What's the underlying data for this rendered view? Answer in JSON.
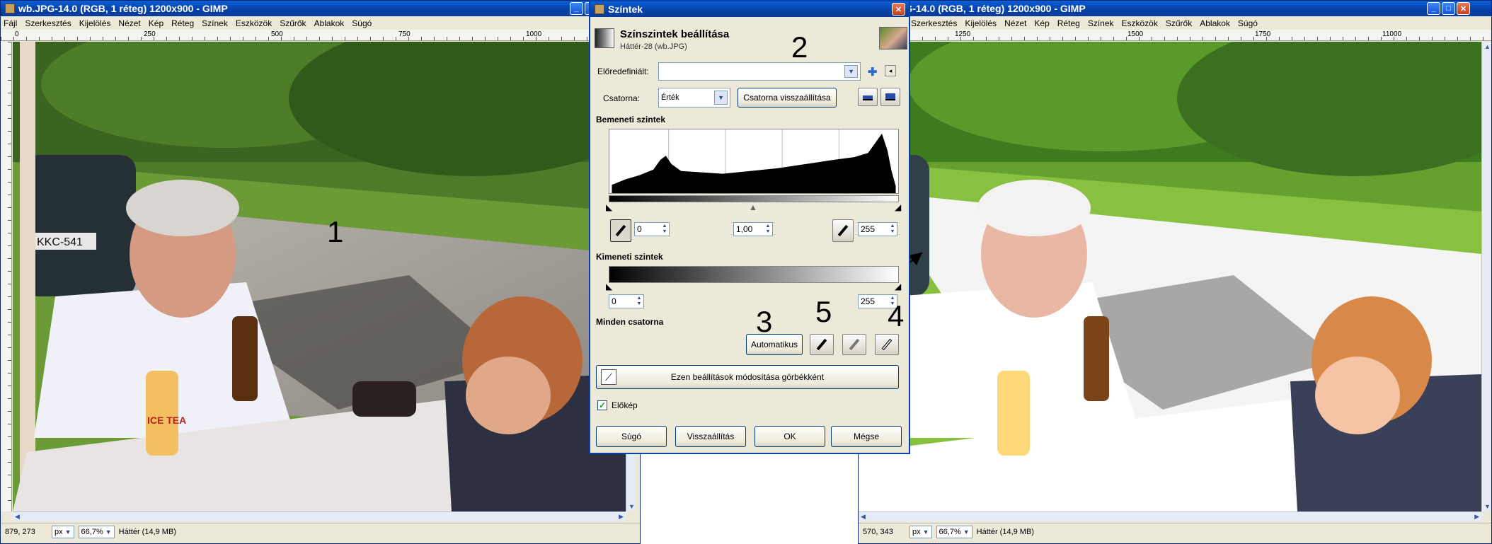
{
  "left_window": {
    "title": "wb.JPG-14.0 (RGB, 1 réteg) 1200x900 - GIMP",
    "menu": [
      "Fájl",
      "Szerkesztés",
      "Kijelölés",
      "Nézet",
      "Kép",
      "Réteg",
      "Színek",
      "Eszközök",
      "Szűrők",
      "Ablakok",
      "Súgó"
    ],
    "ruler_labels": [
      "0",
      "250",
      "500",
      "750",
      "1000"
    ],
    "status": {
      "coords": "879, 273",
      "unit": "px",
      "zoom": "66,7%",
      "layer_info": "Háttér (14,9 MB)"
    }
  },
  "right_window": {
    "title": "wb.JPG-14.0 (RGB, 1 réteg) 1200x900 - GIMP",
    "menu": [
      "Szerkesztés",
      "Kijelölés",
      "Nézet",
      "Kép",
      "Réteg",
      "Színek",
      "Eszközök",
      "Szűrők",
      "Ablakok",
      "Súgó"
    ],
    "ruler_labels": [
      "1250",
      "1500",
      "1750",
      "11000"
    ],
    "status": {
      "coords": "570, 343",
      "unit": "px",
      "zoom": "66,7%",
      "layer_info": "Háttér (14,9 MB)"
    }
  },
  "photo": {
    "license_plate": "KKC-541",
    "bottle_label": "ICE TEA"
  },
  "dialog": {
    "title": "Színtek",
    "header_title": "Színszintek beállítása",
    "header_subtitle": "Háttér-28 (wb.JPG)",
    "preset_label": "Előredefiniált:",
    "preset_value": "",
    "channel_label": "Csatorna:",
    "channel_value": "Érték",
    "reset_channel_button": "Csatorna visszaállítása",
    "input_levels_label": "Bemeneti szintek",
    "input_low": "0",
    "input_gamma": "1,00",
    "input_high": "255",
    "output_levels_label": "Kimeneti szintek",
    "output_low": "0",
    "output_high": "255",
    "all_channels_label": "Minden csatorna",
    "auto_button": "Automatikus",
    "curves_button": "Ezen beállítások módosítása görbékként",
    "preview_label": "Előkép",
    "preview_checked": true,
    "help_button": "Súgó",
    "reset_button": "Visszaállítás",
    "ok_button": "OK",
    "cancel_button": "Mégse"
  },
  "annotations": [
    "1",
    "2",
    "3",
    "4",
    "5"
  ],
  "colors": {
    "xp_title": "#0842a8",
    "dialog_bg": "#ece9d8",
    "close": "#c6401c"
  }
}
